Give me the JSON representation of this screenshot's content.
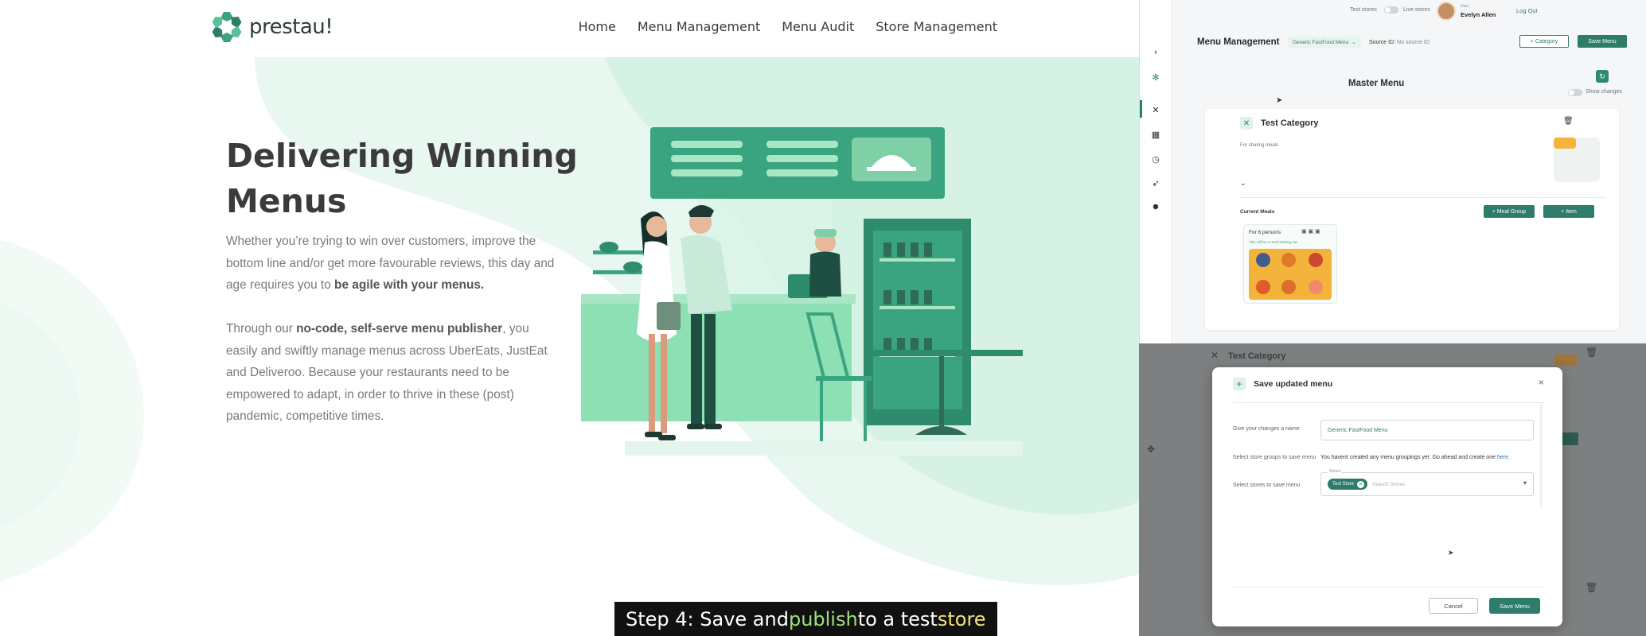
{
  "site": {
    "logo_text": "prestau!",
    "nav": [
      "Home",
      "Menu Management",
      "Menu Audit",
      "Store Management"
    ],
    "hero_title": "Delivering Winning Menus",
    "p1_text": "Whether you’re trying to win over customers, improve the bottom line and/or get more favourable reviews, this day and age requires you to ",
    "p1_bold": "be agile with your menus.",
    "p2_pre": "Through our ",
    "p2_bold": "no-code, self-serve menu publisher",
    "p2_post": ", you easily and swiftly manage menus across UberEats, JustEat and Deliveroo. Because your restaurants need to be empowered to adapt, in order to thrive in these (post) pandemic, competitive times.",
    "colors": {
      "primary": "#2e8b6e",
      "light": "#e6f6ef",
      "mid": "#8ddfb4"
    }
  },
  "caption": {
    "part1": "Step 4: Save and ",
    "part2": "publish",
    "part3": " to a test ",
    "part4": "store"
  },
  "app": {
    "test_stores": "Test stores",
    "live_stores": "Live stores",
    "user_role": "User",
    "user_name": "Evelyn Allen",
    "logout": "Log Out",
    "page_title": "Menu Management",
    "menu_select": "Generic FastFood Menu",
    "source_id_label": "Source ID:",
    "source_id_value": "No source ID",
    "add_category": "+ Category",
    "save_menu": "Save Menu",
    "master_menu": "Master Menu",
    "show_changes": "Show changes",
    "category_name": "Test Category",
    "category_desc": "For sharing meals",
    "current_meals": "Current Meals",
    "add_meal_group": "+ Meal Group",
    "add_item": "+ Item",
    "meal_group_name": "For 6 persons",
    "meal_group_desc": "This will be a meal sharing cat",
    "sidebar_icons": [
      "chevron-right-icon",
      "logo-icon",
      "utensils-icon",
      "store-icon",
      "clock-icon",
      "rocket-icon",
      "gear-icon"
    ]
  },
  "modal": {
    "bg_category": "Test Category",
    "title": "Save updated menu",
    "name_label": "Give your changes a name",
    "name_value": "Generic FastFood Menu",
    "groups_label": "Select store groups to save menu",
    "groups_text": "You havent created any menu groupings yet. Go ahead and create one ",
    "groups_link": "here.",
    "stores_label": "Select stores to save menu",
    "stores_legend": "Stores",
    "store_chip": "Test Store",
    "stores_placeholder": "Search Stores",
    "cancel": "Cancel",
    "save": "Save Menu"
  }
}
